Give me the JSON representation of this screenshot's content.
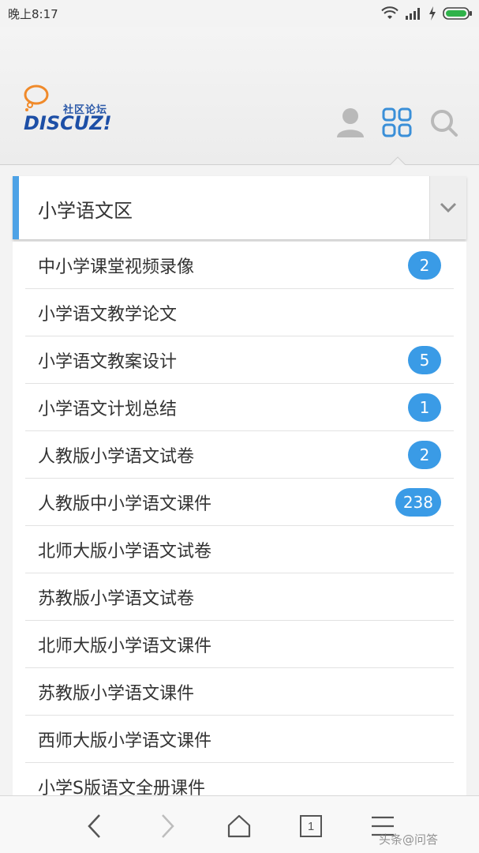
{
  "status_bar": {
    "time": "晚上8:17"
  },
  "header": {
    "logo_cn": "社区论坛",
    "logo_en": "DISCUZ!"
  },
  "select": {
    "current": "小学语文区"
  },
  "forums": [
    {
      "name": "中小学课堂视频录像",
      "count": "2"
    },
    {
      "name": "小学语文教学论文",
      "count": ""
    },
    {
      "name": "小学语文教案设计",
      "count": "5"
    },
    {
      "name": "小学语文计划总结",
      "count": "1"
    },
    {
      "name": "人教版小学语文试卷",
      "count": "2"
    },
    {
      "name": "人教版中小学语文课件",
      "count": "238"
    },
    {
      "name": "北师大版小学语文试卷",
      "count": ""
    },
    {
      "name": "苏教版小学语文试卷",
      "count": ""
    },
    {
      "name": "北师大版小学语文课件",
      "count": ""
    },
    {
      "name": "苏教版小学语文课件",
      "count": ""
    },
    {
      "name": "西师大版小学语文课件",
      "count": ""
    },
    {
      "name": "小学S版语文全册课件",
      "count": ""
    }
  ],
  "bottom_nav": {
    "tab_count": "1",
    "watermark": "头条@问答"
  },
  "colors": {
    "accent": "#4da2e6",
    "badge": "#3a9be6",
    "logo_blue": "#1d4fa6",
    "icon_blue": "#3a8fd8"
  }
}
